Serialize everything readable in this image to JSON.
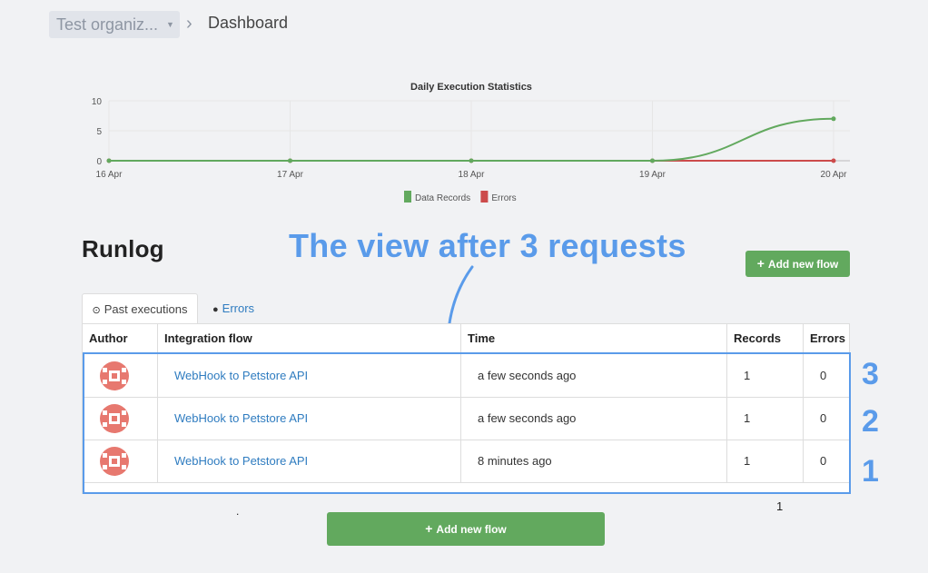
{
  "breadcrumb": {
    "org_label": "Test organiz...",
    "caret": "▼",
    "separator": "›",
    "current": "Dashboard"
  },
  "chart_data": {
    "type": "line",
    "title": "Daily Execution Statistics",
    "x": [
      "16 Apr",
      "17 Apr",
      "18 Apr",
      "19 Apr",
      "20 Apr"
    ],
    "ylim": [
      0,
      10
    ],
    "yticks": [
      0,
      5,
      10
    ],
    "grid": true,
    "legend_position": "bottom",
    "series": [
      {
        "name": "Data Records",
        "color": "#62a95e",
        "values": [
          0,
          0,
          0,
          0,
          7
        ]
      },
      {
        "name": "Errors",
        "color": "#cc4b4b",
        "values": [
          0,
          0,
          0,
          0,
          0
        ]
      }
    ]
  },
  "runlog": {
    "title": "Runlog",
    "annotation": "The view after 3 requests",
    "add_flow_label": "Add new flow",
    "tabs": [
      {
        "label": "Past executions",
        "icon": "clock-icon"
      },
      {
        "label": "Errors",
        "icon": "exclamation-circle-icon"
      }
    ],
    "columns": [
      "Author",
      "Integration flow",
      "Time",
      "Records",
      "Errors"
    ],
    "rows": [
      {
        "flow": "WebHook to Petstore API",
        "time": "a few seconds ago",
        "records": "1",
        "errors": "0",
        "marker": "3"
      },
      {
        "flow": "WebHook to Petstore API",
        "time": "a few seconds ago",
        "records": "1",
        "errors": "0",
        "marker": "2"
      },
      {
        "flow": "WebHook to Petstore API",
        "time": "8 minutes ago",
        "records": "1",
        "errors": "0",
        "marker": "1"
      }
    ],
    "pagination": "1",
    "stray_dot": "."
  },
  "colors": {
    "accent_green": "#62a95e",
    "link_blue": "#2f7cc0",
    "annotation_blue": "#5a9bea",
    "error_red": "#cc4b4b"
  }
}
